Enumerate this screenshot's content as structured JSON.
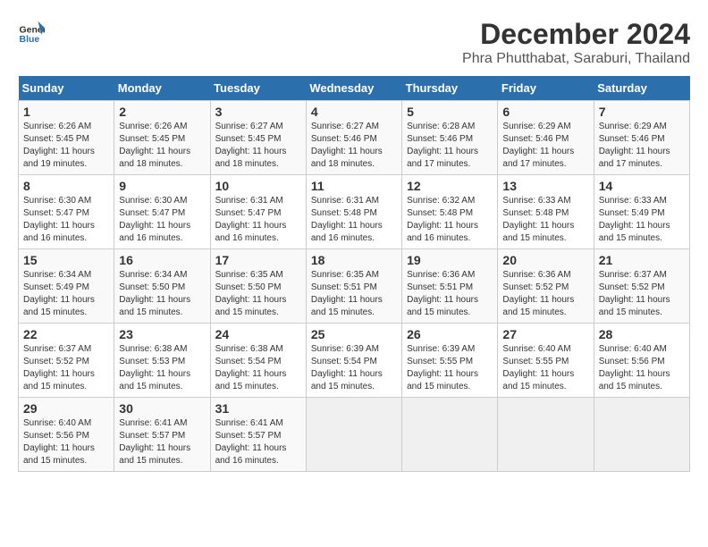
{
  "logo": {
    "general": "General",
    "blue": "Blue"
  },
  "title": "December 2024",
  "subtitle": "Phra Phutthabat, Saraburi, Thailand",
  "days_of_week": [
    "Sunday",
    "Monday",
    "Tuesday",
    "Wednesday",
    "Thursday",
    "Friday",
    "Saturday"
  ],
  "weeks": [
    [
      {
        "day": "1",
        "sunrise": "6:26 AM",
        "sunset": "5:45 PM",
        "daylight": "11 hours and 19 minutes."
      },
      {
        "day": "2",
        "sunrise": "6:26 AM",
        "sunset": "5:45 PM",
        "daylight": "11 hours and 18 minutes."
      },
      {
        "day": "3",
        "sunrise": "6:27 AM",
        "sunset": "5:45 PM",
        "daylight": "11 hours and 18 minutes."
      },
      {
        "day": "4",
        "sunrise": "6:27 AM",
        "sunset": "5:46 PM",
        "daylight": "11 hours and 18 minutes."
      },
      {
        "day": "5",
        "sunrise": "6:28 AM",
        "sunset": "5:46 PM",
        "daylight": "11 hours and 17 minutes."
      },
      {
        "day": "6",
        "sunrise": "6:29 AM",
        "sunset": "5:46 PM",
        "daylight": "11 hours and 17 minutes."
      },
      {
        "day": "7",
        "sunrise": "6:29 AM",
        "sunset": "5:46 PM",
        "daylight": "11 hours and 17 minutes."
      }
    ],
    [
      {
        "day": "8",
        "sunrise": "6:30 AM",
        "sunset": "5:47 PM",
        "daylight": "11 hours and 16 minutes."
      },
      {
        "day": "9",
        "sunrise": "6:30 AM",
        "sunset": "5:47 PM",
        "daylight": "11 hours and 16 minutes."
      },
      {
        "day": "10",
        "sunrise": "6:31 AM",
        "sunset": "5:47 PM",
        "daylight": "11 hours and 16 minutes."
      },
      {
        "day": "11",
        "sunrise": "6:31 AM",
        "sunset": "5:48 PM",
        "daylight": "11 hours and 16 minutes."
      },
      {
        "day": "12",
        "sunrise": "6:32 AM",
        "sunset": "5:48 PM",
        "daylight": "11 hours and 16 minutes."
      },
      {
        "day": "13",
        "sunrise": "6:33 AM",
        "sunset": "5:48 PM",
        "daylight": "11 hours and 15 minutes."
      },
      {
        "day": "14",
        "sunrise": "6:33 AM",
        "sunset": "5:49 PM",
        "daylight": "11 hours and 15 minutes."
      }
    ],
    [
      {
        "day": "15",
        "sunrise": "6:34 AM",
        "sunset": "5:49 PM",
        "daylight": "11 hours and 15 minutes."
      },
      {
        "day": "16",
        "sunrise": "6:34 AM",
        "sunset": "5:50 PM",
        "daylight": "11 hours and 15 minutes."
      },
      {
        "day": "17",
        "sunrise": "6:35 AM",
        "sunset": "5:50 PM",
        "daylight": "11 hours and 15 minutes."
      },
      {
        "day": "18",
        "sunrise": "6:35 AM",
        "sunset": "5:51 PM",
        "daylight": "11 hours and 15 minutes."
      },
      {
        "day": "19",
        "sunrise": "6:36 AM",
        "sunset": "5:51 PM",
        "daylight": "11 hours and 15 minutes."
      },
      {
        "day": "20",
        "sunrise": "6:36 AM",
        "sunset": "5:52 PM",
        "daylight": "11 hours and 15 minutes."
      },
      {
        "day": "21",
        "sunrise": "6:37 AM",
        "sunset": "5:52 PM",
        "daylight": "11 hours and 15 minutes."
      }
    ],
    [
      {
        "day": "22",
        "sunrise": "6:37 AM",
        "sunset": "5:52 PM",
        "daylight": "11 hours and 15 minutes."
      },
      {
        "day": "23",
        "sunrise": "6:38 AM",
        "sunset": "5:53 PM",
        "daylight": "11 hours and 15 minutes."
      },
      {
        "day": "24",
        "sunrise": "6:38 AM",
        "sunset": "5:54 PM",
        "daylight": "11 hours and 15 minutes."
      },
      {
        "day": "25",
        "sunrise": "6:39 AM",
        "sunset": "5:54 PM",
        "daylight": "11 hours and 15 minutes."
      },
      {
        "day": "26",
        "sunrise": "6:39 AM",
        "sunset": "5:55 PM",
        "daylight": "11 hours and 15 minutes."
      },
      {
        "day": "27",
        "sunrise": "6:40 AM",
        "sunset": "5:55 PM",
        "daylight": "11 hours and 15 minutes."
      },
      {
        "day": "28",
        "sunrise": "6:40 AM",
        "sunset": "5:56 PM",
        "daylight": "11 hours and 15 minutes."
      }
    ],
    [
      {
        "day": "29",
        "sunrise": "6:40 AM",
        "sunset": "5:56 PM",
        "daylight": "11 hours and 15 minutes."
      },
      {
        "day": "30",
        "sunrise": "6:41 AM",
        "sunset": "5:57 PM",
        "daylight": "11 hours and 15 minutes."
      },
      {
        "day": "31",
        "sunrise": "6:41 AM",
        "sunset": "5:57 PM",
        "daylight": "11 hours and 16 minutes."
      },
      null,
      null,
      null,
      null
    ]
  ]
}
